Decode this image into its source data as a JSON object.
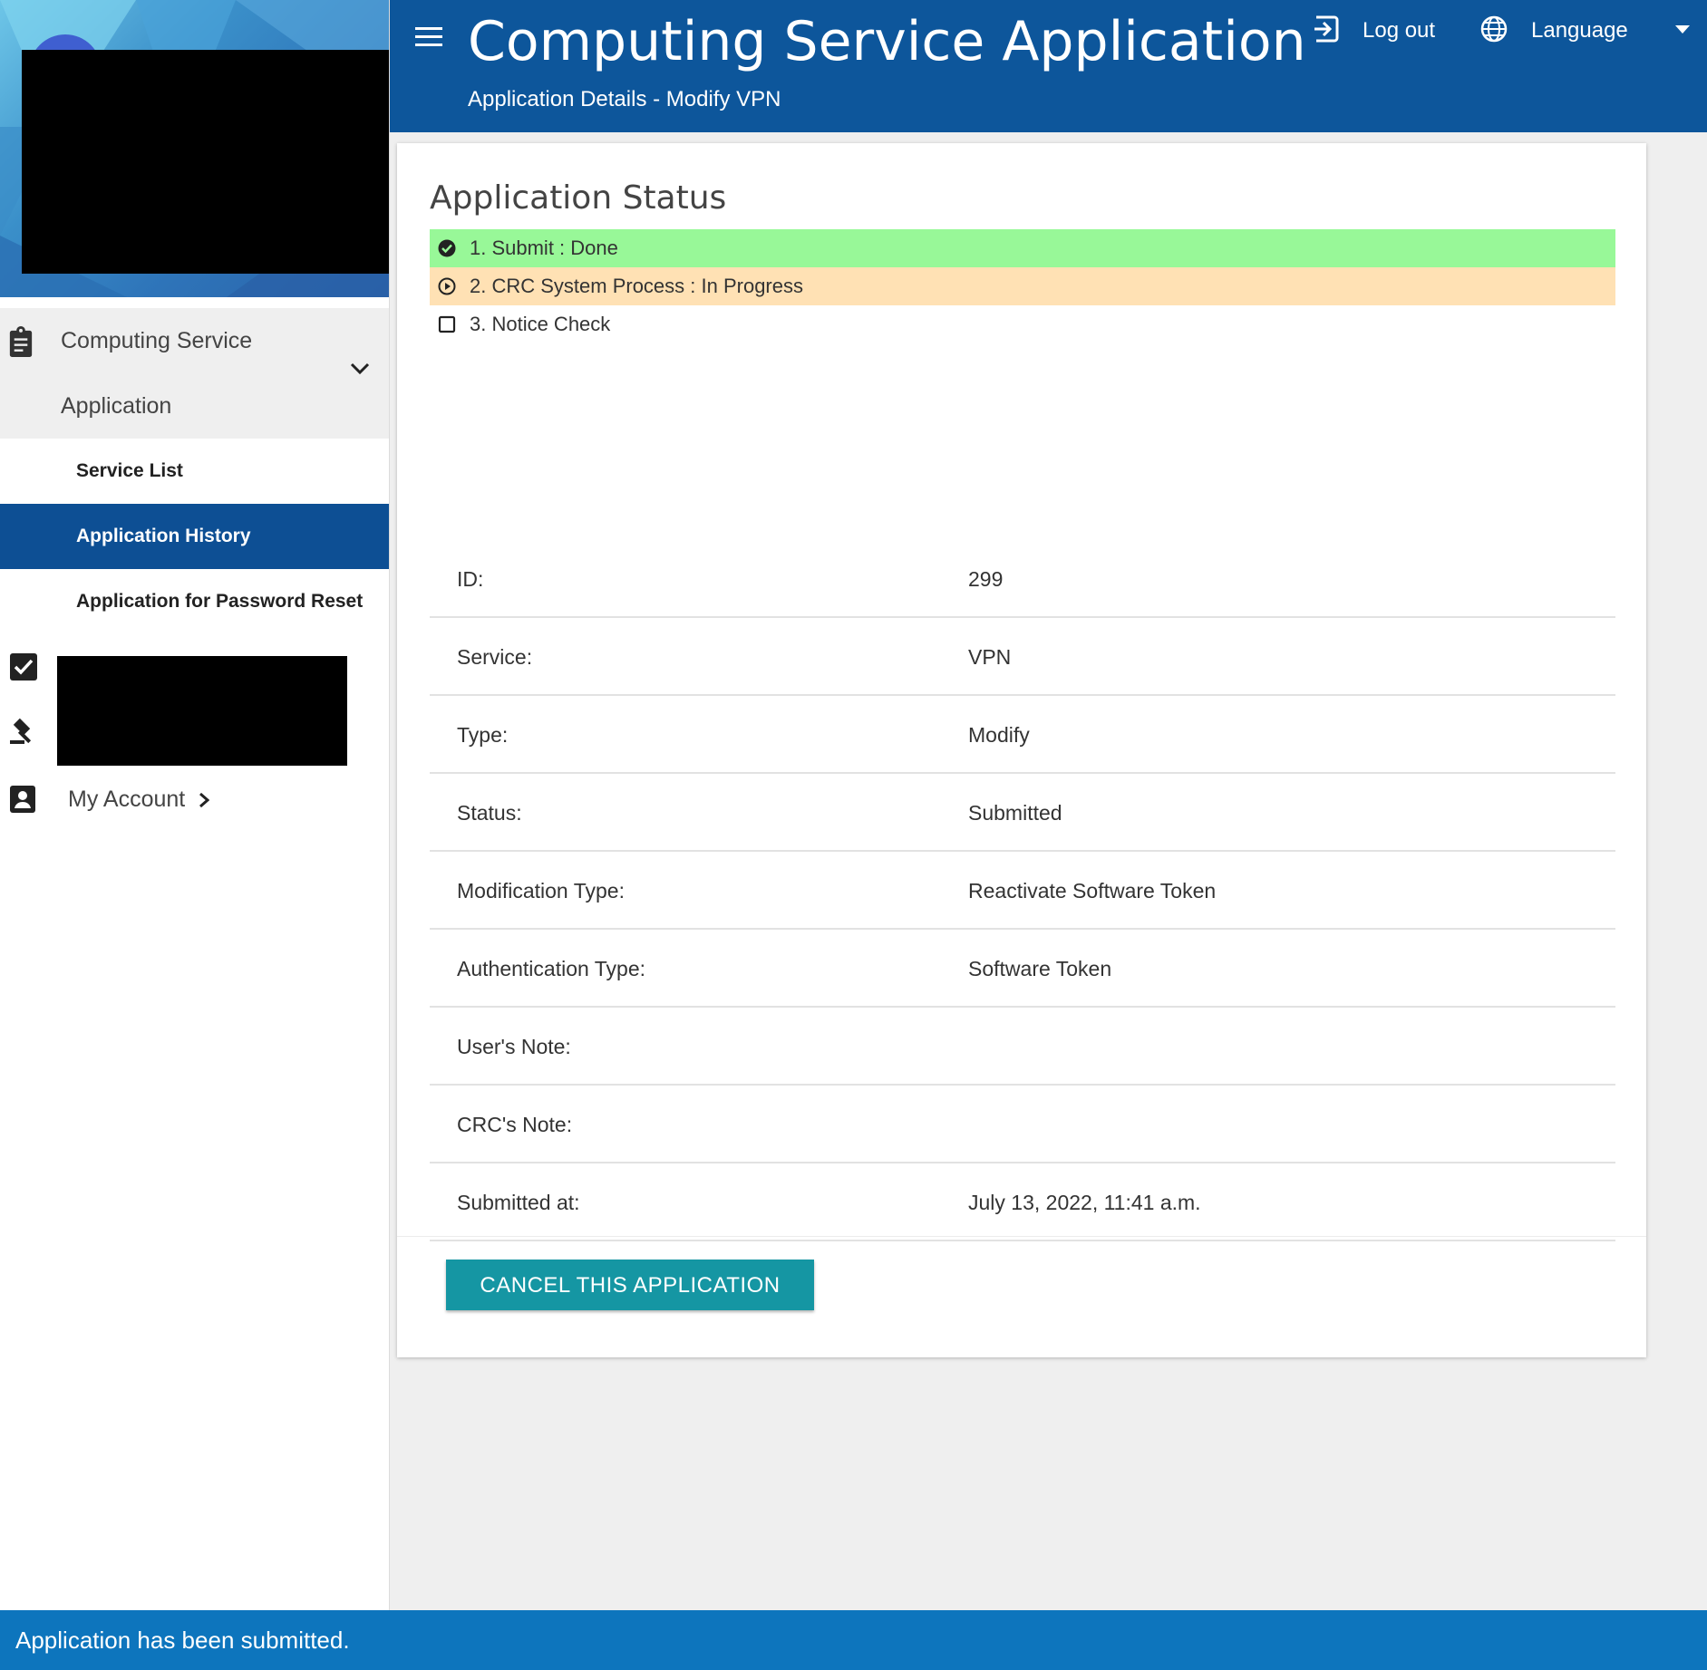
{
  "header": {
    "title": "Computing Service Application",
    "subtitle": "Application Details - Modify VPN",
    "logout_label": "Log out",
    "language_label": "Language"
  },
  "sidebar": {
    "group_label_line1": "Computing Service",
    "group_label_line2": "Application",
    "items": [
      {
        "label": "Service List",
        "active": false
      },
      {
        "label": "Application History",
        "active": true
      },
      {
        "label": "Application for Password Reset",
        "active": false
      }
    ],
    "account_label": "My Account"
  },
  "status": {
    "heading": "Application Status",
    "steps": [
      {
        "label": "1. Submit : Done",
        "state": "done",
        "color": "#98f898",
        "icon": "check-circle-icon"
      },
      {
        "label": "2. CRC System Process : In Progress",
        "state": "in-progress",
        "color": "#ffe1b4",
        "icon": "play-circle-icon"
      },
      {
        "label": "3. Notice Check",
        "state": "pending",
        "color": "#ffffff",
        "icon": "empty-checkbox-icon"
      }
    ]
  },
  "details": [
    {
      "key": "ID:",
      "value": "299"
    },
    {
      "key": "Service:",
      "value": "VPN"
    },
    {
      "key": "Type:",
      "value": "Modify"
    },
    {
      "key": "Status:",
      "value": "Submitted"
    },
    {
      "key": "Modification Type:",
      "value": "Reactivate Software Token"
    },
    {
      "key": "Authentication Type:",
      "value": "Software Token"
    },
    {
      "key": "User's Note:",
      "value": ""
    },
    {
      "key": "CRC's Note:",
      "value": ""
    },
    {
      "key": "Submitted at:",
      "value": "July 13, 2022, 11:41 a.m."
    }
  ],
  "actions": {
    "cancel_label": "CANCEL THIS APPLICATION"
  },
  "snackbar": {
    "message": "Application has been submitted."
  },
  "colors": {
    "header_bg": "#0d569b",
    "active_nav": "#0d4f94",
    "cancel_button": "#1596a3",
    "snackbar_bg": "#0d75bd"
  }
}
